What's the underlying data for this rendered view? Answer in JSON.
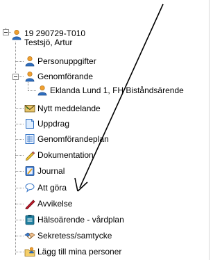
{
  "tree": {
    "root": {
      "id_line": "19 290729-T010",
      "name_line": "Testsjö, Artur",
      "icon": "person-icon"
    },
    "items": [
      {
        "key": "personuppgifter",
        "label": "Personuppgifter",
        "icon": "person-icon"
      },
      {
        "key": "genomforande",
        "label": "Genomförande",
        "icon": "person-icon",
        "children": [
          {
            "key": "eklanda",
            "label": "Eklanda Lund 1, FH Biståndsärende",
            "icon": "person-icon"
          }
        ]
      },
      {
        "key": "nytt-meddelande",
        "label": "Nytt meddelande",
        "icon": "envelope-icon"
      },
      {
        "key": "uppdrag",
        "label": "Uppdrag",
        "icon": "document-icon"
      },
      {
        "key": "genomforandeplan",
        "label": "Genomförandeplan",
        "icon": "plan-icon"
      },
      {
        "key": "dokumentation",
        "label": "Dokumentation",
        "icon": "pencil-icon"
      },
      {
        "key": "journal",
        "label": "Journal",
        "icon": "journal-icon"
      },
      {
        "key": "att-gora",
        "label": "Att göra",
        "icon": "speech-bubble-icon"
      },
      {
        "key": "avvikelse",
        "label": "Avvikelse",
        "icon": "red-pen-icon"
      },
      {
        "key": "halsoarende",
        "label": "Hälsoärende - vårdplan",
        "icon": "clipboard-icon"
      },
      {
        "key": "sekretess",
        "label": "Sekretess/samtycke",
        "icon": "handshake-icon"
      },
      {
        "key": "lagg-till",
        "label": "Lägg till mina personer",
        "icon": "folder-person-icon"
      }
    ]
  },
  "colors": {
    "person_head": "#f0a030",
    "person_body": "#2f6fc0",
    "arrow": "#000000",
    "avvikelse_red": "#c0182a"
  }
}
